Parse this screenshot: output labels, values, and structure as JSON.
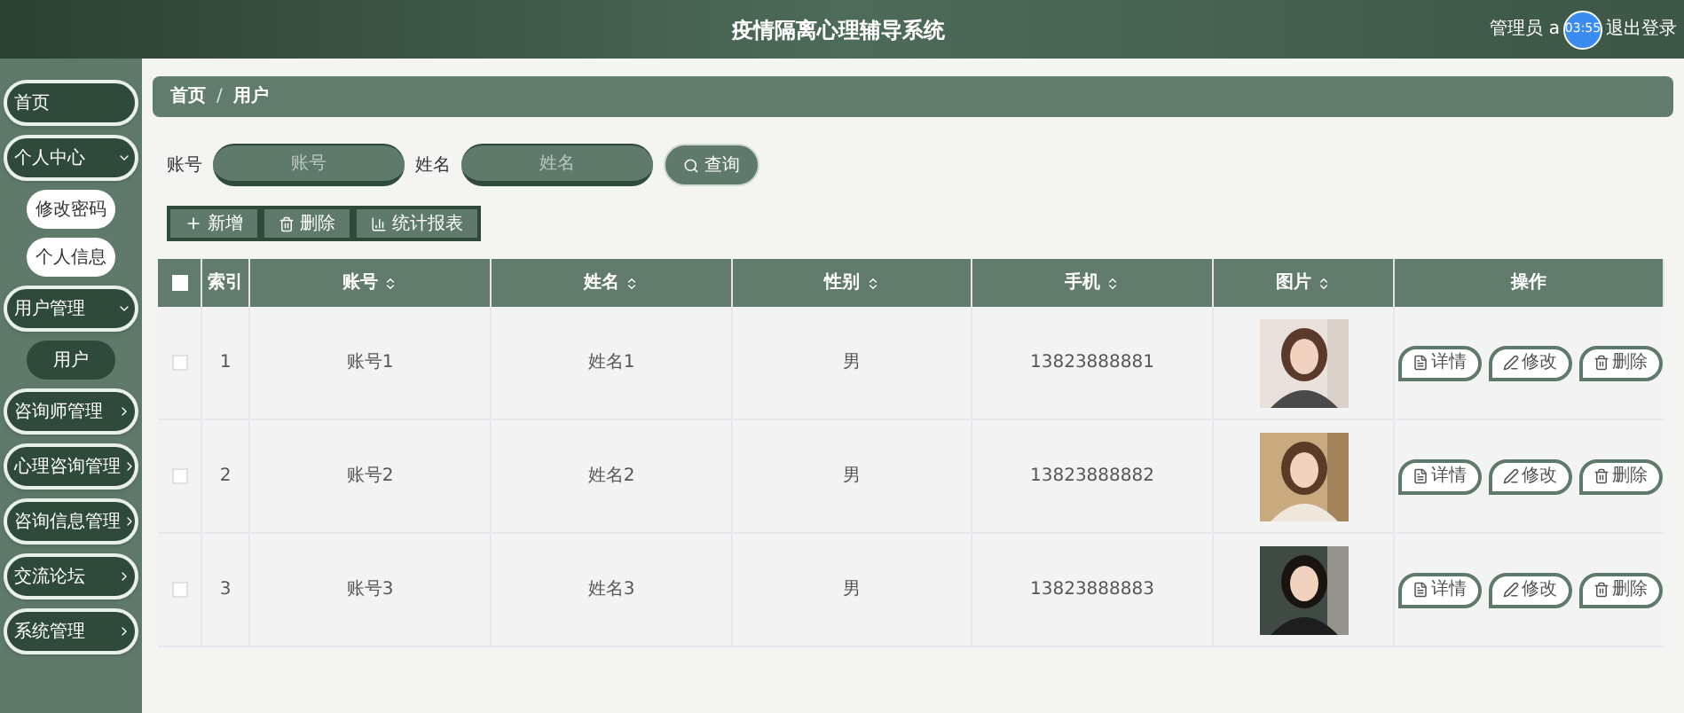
{
  "header": {
    "title": "疫情隔离心理辅导系统",
    "user": "管理员 a",
    "timer_badge": "03:55",
    "logout": "退出登录"
  },
  "sidebar": {
    "items": [
      {
        "label": "首页",
        "kind": "link"
      },
      {
        "label": "个人中心",
        "kind": "menu",
        "expanded": true,
        "children": [
          {
            "label": "修改密码",
            "selected": false
          },
          {
            "label": "个人信息",
            "selected": false
          }
        ]
      },
      {
        "label": "用户管理",
        "kind": "menu",
        "expanded": true,
        "children": [
          {
            "label": "用户",
            "selected": true
          }
        ]
      },
      {
        "label": "咨询师管理",
        "kind": "menu",
        "expanded": false
      },
      {
        "label": "心理咨询管理",
        "kind": "menu",
        "expanded": false
      },
      {
        "label": "咨询信息管理",
        "kind": "menu",
        "expanded": false
      },
      {
        "label": "交流论坛",
        "kind": "menu",
        "expanded": false
      },
      {
        "label": "系统管理",
        "kind": "menu",
        "expanded": false
      }
    ]
  },
  "breadcrumb": {
    "separator": "/",
    "items": [
      "首页",
      "用户"
    ]
  },
  "search": {
    "fields": [
      {
        "label": "账号",
        "placeholder": "账号"
      },
      {
        "label": "姓名",
        "placeholder": "姓名"
      }
    ],
    "button": "查询"
  },
  "toolbar": [
    {
      "label": "新增",
      "kind": "add"
    },
    {
      "label": "删除",
      "kind": "delete"
    },
    {
      "label": "统计报表",
      "kind": "chart"
    }
  ],
  "table": {
    "select_all": {
      "checked": false
    },
    "columns": [
      {
        "label": "索引",
        "sortable": false
      },
      {
        "label": "账号",
        "sortable": true
      },
      {
        "label": "姓名",
        "sortable": true
      },
      {
        "label": "性别",
        "sortable": true
      },
      {
        "label": "手机",
        "sortable": true
      },
      {
        "label": "图片",
        "sortable": true
      },
      {
        "label": "操作",
        "sortable": false
      }
    ],
    "rows": [
      {
        "checked": false,
        "cells": [
          "1",
          "账号1",
          "姓名1",
          "男",
          "13823888881"
        ],
        "actions": [
          {
            "label": "详情",
            "kind": "detail"
          },
          {
            "label": "修改",
            "kind": "edit"
          },
          {
            "label": "删除",
            "kind": "delete"
          }
        ]
      },
      {
        "checked": false,
        "cells": [
          "2",
          "账号2",
          "姓名2",
          "男",
          "13823888882"
        ],
        "actions": [
          {
            "label": "详情",
            "kind": "detail"
          },
          {
            "label": "修改",
            "kind": "edit"
          },
          {
            "label": "删除",
            "kind": "delete"
          }
        ]
      },
      {
        "checked": false,
        "cells": [
          "3",
          "账号3",
          "姓名3",
          "男",
          "13823888883"
        ],
        "actions": [
          {
            "label": "详情",
            "kind": "detail"
          },
          {
            "label": "修改",
            "kind": "edit"
          },
          {
            "label": "删除",
            "kind": "delete"
          }
        ]
      }
    ]
  }
}
